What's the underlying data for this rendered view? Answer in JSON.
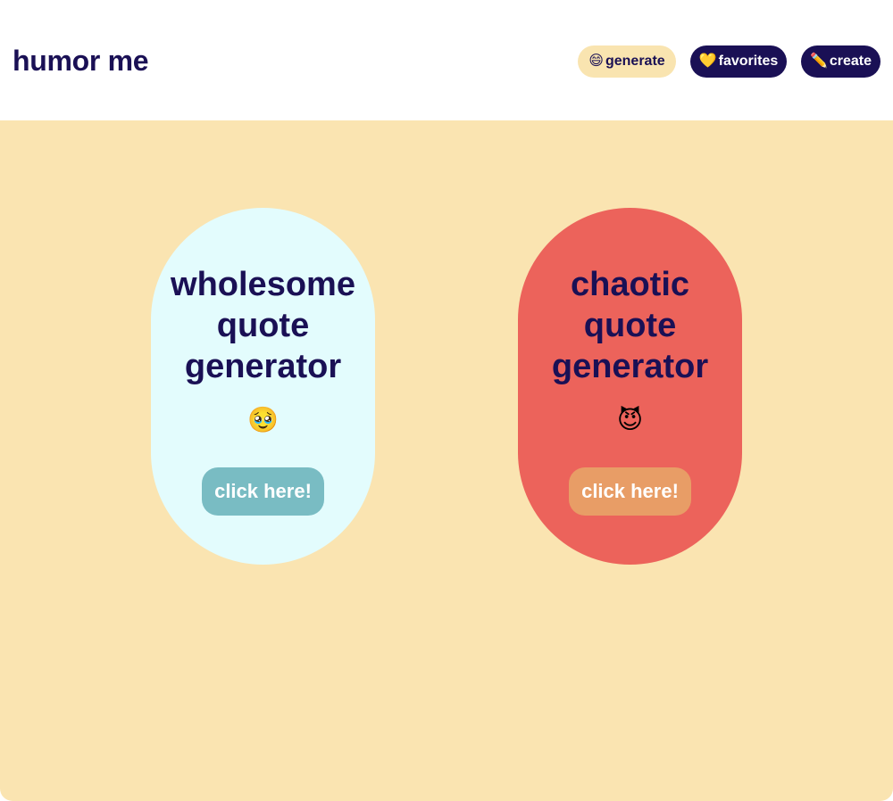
{
  "header": {
    "title": "humor me",
    "nav": [
      {
        "emoji": "😄",
        "label": "generate",
        "active": true
      },
      {
        "emoji": "💛",
        "label": "favorites",
        "active": false
      },
      {
        "emoji": "✏️",
        "label": "create",
        "active": false
      }
    ]
  },
  "cards": [
    {
      "title": "wholesome\nquote\ngenerator",
      "emoji": "🥹",
      "button_label": "click here!",
      "color": "#e3fcfd",
      "button_color": "#79bcc3"
    },
    {
      "title": "chaotic\nquote\ngenerator",
      "emoji": "😈",
      "button_label": "click here!",
      "color": "#ec635b",
      "button_color": "#e89d66"
    }
  ],
  "colors": {
    "background": "#fae4b1",
    "header_bg": "#ffffff",
    "text": "#1a1055"
  }
}
